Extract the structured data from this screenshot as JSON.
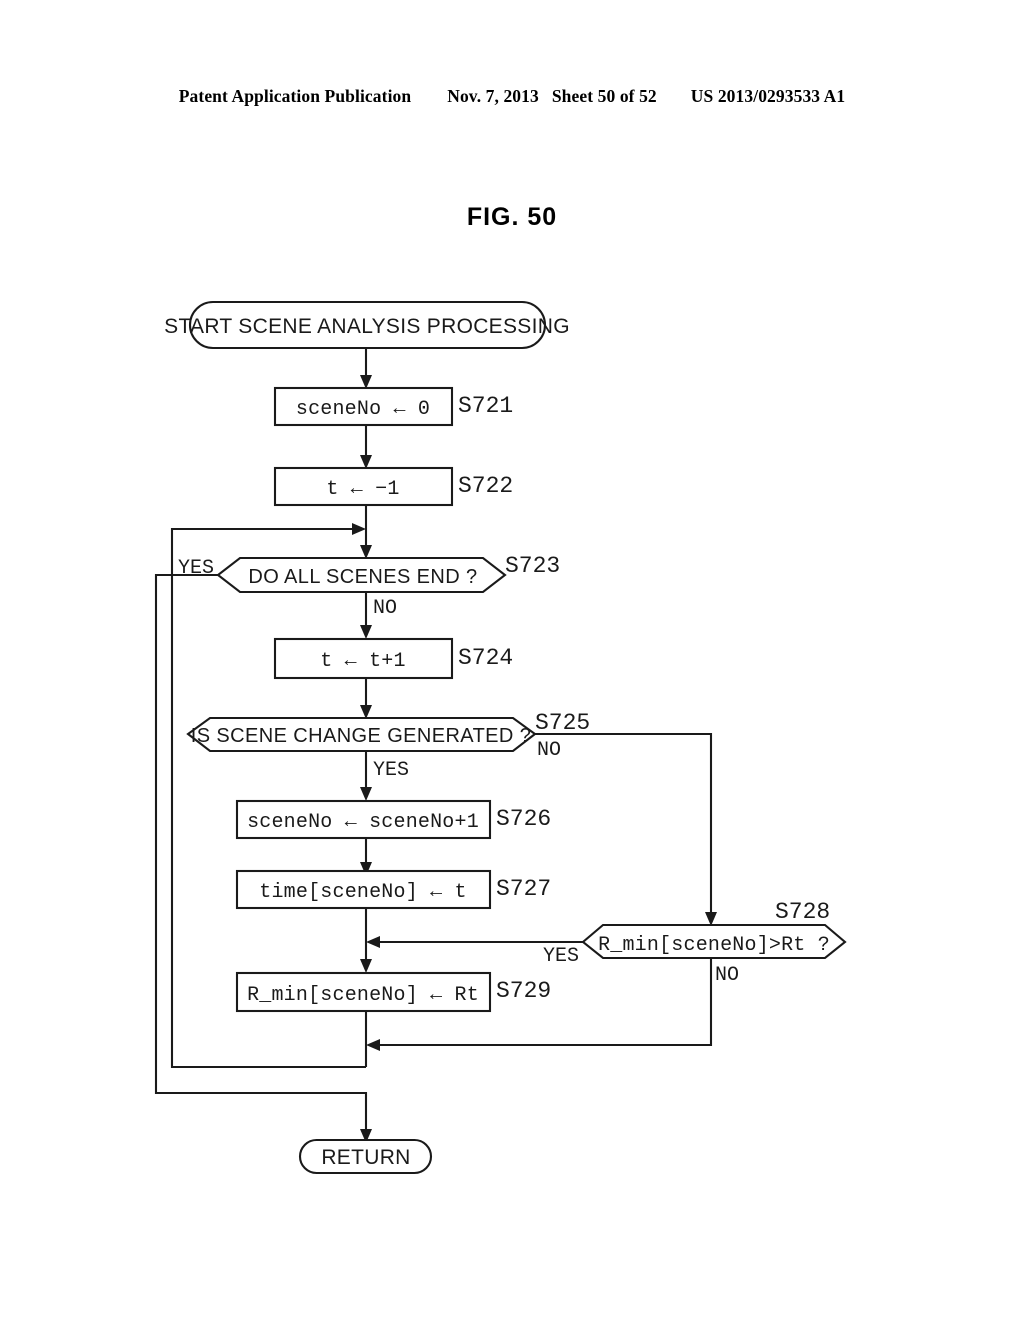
{
  "header": {
    "publication": "Patent Application Publication",
    "date": "Nov. 7, 2013",
    "sheet": "Sheet 50 of 52",
    "patent_number": "US 2013/0293533 A1"
  },
  "figure": {
    "title": "FIG. 50"
  },
  "chart_data": {
    "type": "diagram",
    "title": "FIG. 50",
    "nodes": [
      {
        "id": "start",
        "shape": "terminator",
        "label": "START SCENE ANALYSIS PROCESSING",
        "step": ""
      },
      {
        "id": "s721",
        "shape": "process",
        "label": "sceneNo ← 0",
        "step": "S721"
      },
      {
        "id": "s722",
        "shape": "process",
        "label": "t ← −1",
        "step": "S722"
      },
      {
        "id": "s723",
        "shape": "decision",
        "label": "DO ALL SCENES END ?",
        "step": "S723"
      },
      {
        "id": "s724",
        "shape": "process",
        "label": "t ← t+1",
        "step": "S724"
      },
      {
        "id": "s725",
        "shape": "decision",
        "label": "IS SCENE CHANGE GENERATED ?",
        "step": "S725"
      },
      {
        "id": "s726",
        "shape": "process",
        "label": "sceneNo ← sceneNo+1",
        "step": "S726"
      },
      {
        "id": "s727",
        "shape": "process",
        "label": "time[sceneNo] ← t",
        "step": "S727"
      },
      {
        "id": "s728",
        "shape": "decision",
        "label": "R_min[sceneNo]>Rt ?",
        "step": "S728"
      },
      {
        "id": "s729",
        "shape": "process",
        "label": "R_min[sceneNo] ← Rt",
        "step": "S729"
      },
      {
        "id": "return",
        "shape": "terminator",
        "label": "RETURN",
        "step": ""
      }
    ],
    "branch_labels": {
      "s723_yes": "YES",
      "s723_no": "NO",
      "s725_yes": "YES",
      "s725_no": "NO",
      "s728_yes": "YES",
      "s728_no": "NO"
    },
    "edges": [
      {
        "from": "start",
        "to": "s721",
        "label": ""
      },
      {
        "from": "s721",
        "to": "s722",
        "label": ""
      },
      {
        "from": "s722",
        "to": "s723",
        "label": ""
      },
      {
        "from": "s723",
        "to": "return",
        "label": "YES"
      },
      {
        "from": "s723",
        "to": "s724",
        "label": "NO"
      },
      {
        "from": "s724",
        "to": "s725",
        "label": ""
      },
      {
        "from": "s725",
        "to": "s726",
        "label": "YES"
      },
      {
        "from": "s725",
        "to": "s728",
        "label": "NO"
      },
      {
        "from": "s726",
        "to": "s727",
        "label": ""
      },
      {
        "from": "s727",
        "to": "s729",
        "label": ""
      },
      {
        "from": "s728",
        "to": "s729",
        "label": "YES"
      },
      {
        "from": "s728",
        "to": "s723",
        "label": "NO"
      },
      {
        "from": "s729",
        "to": "s723",
        "label": ""
      }
    ]
  }
}
